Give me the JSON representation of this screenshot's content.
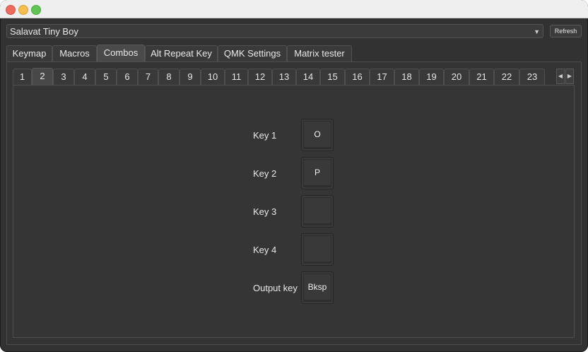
{
  "device": {
    "name": "Salavat Tiny Boy",
    "refresh_label": "Refresh"
  },
  "main_tabs": [
    {
      "label": "Keymap"
    },
    {
      "label": "Macros"
    },
    {
      "label": "Combos",
      "active": true
    },
    {
      "label": "Alt Repeat Key"
    },
    {
      "label": "QMK Settings"
    },
    {
      "label": "Matrix tester"
    }
  ],
  "combo_tabs": {
    "selected": "2",
    "labels": [
      "1",
      "2",
      "3",
      "4",
      "5",
      "6",
      "7",
      "8",
      "9",
      "10",
      "11",
      "12",
      "13",
      "14",
      "15",
      "16",
      "17",
      "18",
      "19",
      "20",
      "21",
      "22",
      "23"
    ]
  },
  "combo": {
    "rows": [
      {
        "label": "Key 1",
        "key": "O"
      },
      {
        "label": "Key 2",
        "key": "P"
      },
      {
        "label": "Key 3",
        "key": ""
      },
      {
        "label": "Key 4",
        "key": ""
      },
      {
        "label": "Output key",
        "key": "Bksp"
      }
    ]
  },
  "icons": {
    "dropdown": "chevron-down-icon",
    "scroll_left": "arrow-left-icon",
    "scroll_right": "arrow-right-icon"
  }
}
